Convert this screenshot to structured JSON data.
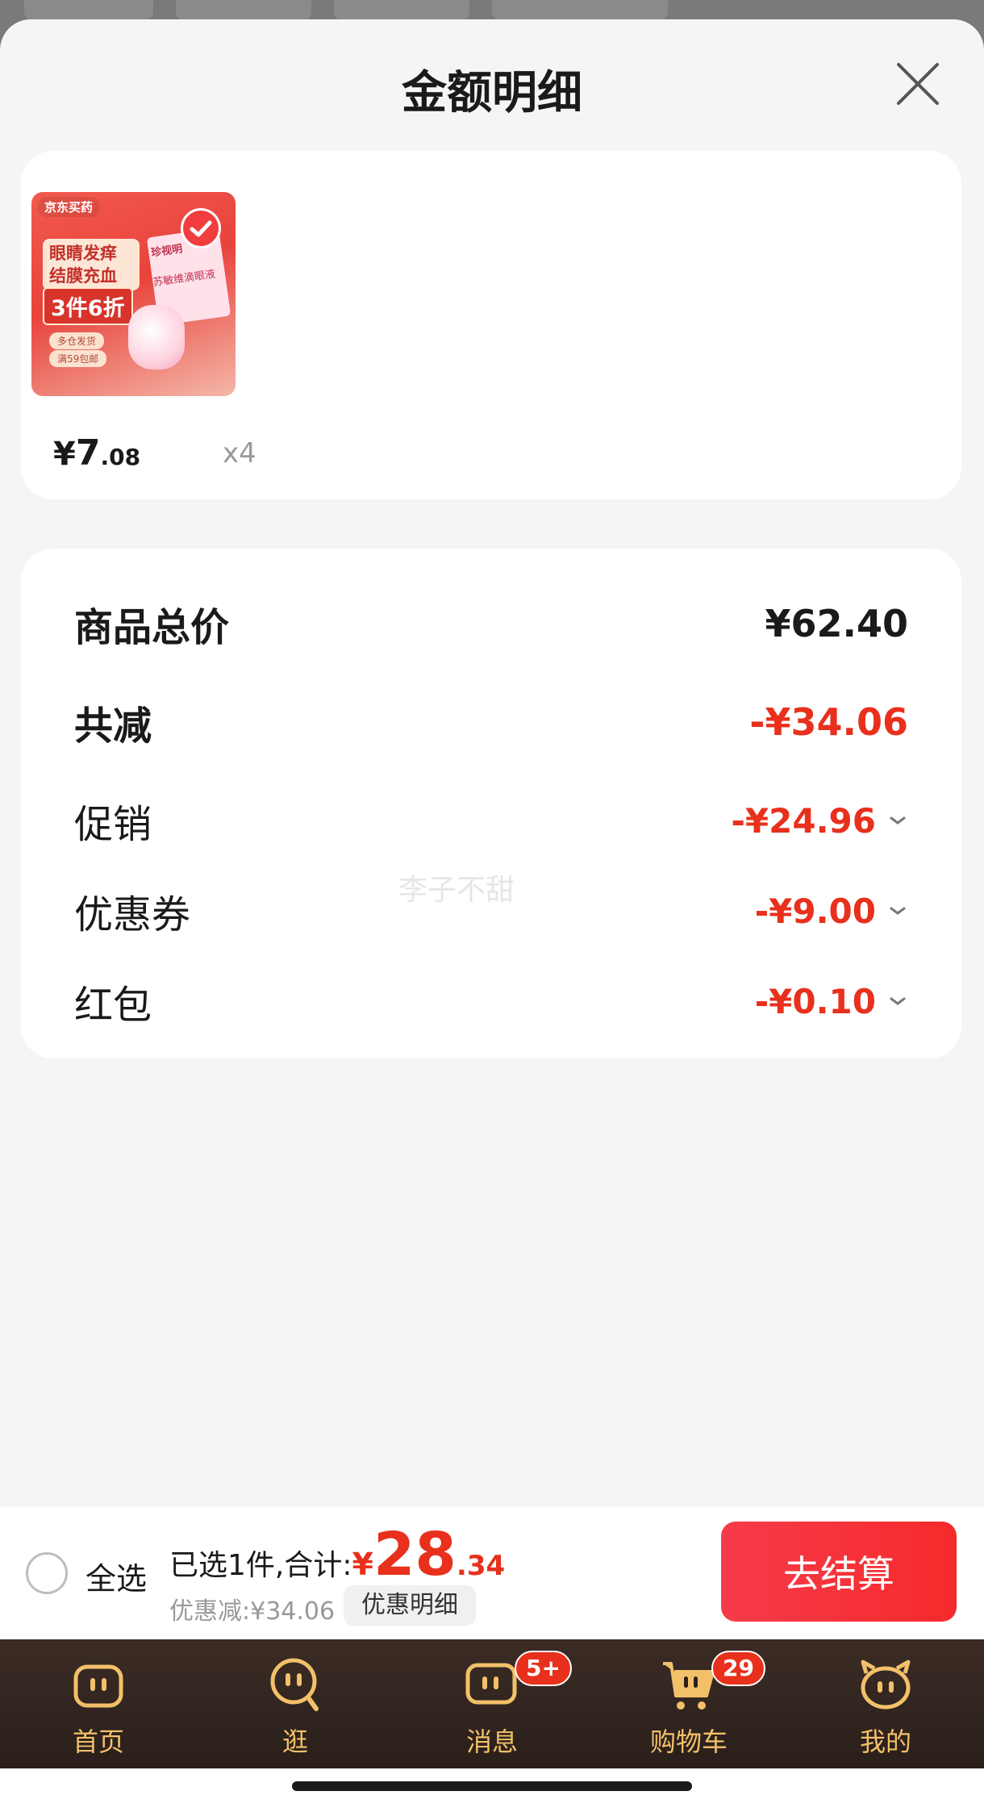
{
  "sheet": {
    "title": "金额明细"
  },
  "product": {
    "thumbnail": {
      "brand": "京东买药",
      "slogan": "眼睛发痒结膜充血",
      "promo": "3件6折",
      "tag1": "多仓发货",
      "tag2": "满59包邮",
      "box_label": "珍视明",
      "box_name": "苏敏维滴眼液"
    },
    "price_yen": "¥",
    "price_int": "7",
    "price_dec": ".08",
    "quantity": "x4"
  },
  "summary": {
    "total_label": "商品总价",
    "total_value": "¥62.40",
    "reduce_label": "共减",
    "reduce_value": "-¥34.06",
    "items": [
      {
        "label": "促销",
        "value": "-¥24.96"
      },
      {
        "label": "优惠券",
        "value": "-¥9.00"
      },
      {
        "label": "红包",
        "value": "-¥0.10"
      }
    ],
    "watermark": "李子不甜"
  },
  "footer": {
    "select_all": "全选",
    "selected_text": "已选1件,合计:",
    "total_yen": "¥",
    "total_int": "28",
    "total_dec": ".34",
    "discount_text": "优惠减:¥34.06",
    "detail_chip": "优惠明细",
    "checkout": "去结算"
  },
  "tabbar": {
    "tabs": [
      {
        "label": "首页",
        "icon": "home-icon"
      },
      {
        "label": "逛",
        "icon": "browse-icon"
      },
      {
        "label": "消息",
        "icon": "message-icon",
        "badge": "5+"
      },
      {
        "label": "购物车",
        "icon": "cart-icon",
        "badge": "29"
      },
      {
        "label": "我的",
        "icon": "profile-icon"
      }
    ]
  },
  "colors": {
    "accent_red": "#e8301c",
    "tab_gold": "#f3c06a",
    "tab_bg": "#2a1f1a"
  }
}
